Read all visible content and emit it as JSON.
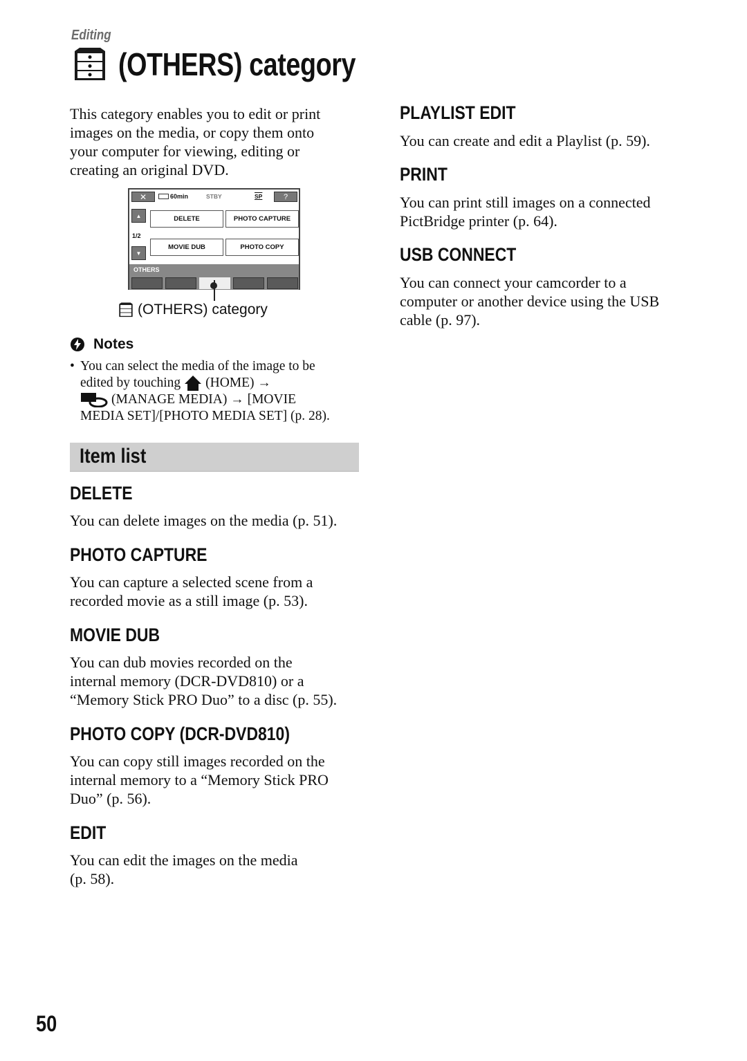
{
  "section_label": "Editing",
  "page_title": "(OTHERS) category",
  "intro": [
    "This category enables you to edit or print",
    "images on the media, or copy them onto",
    "your computer for viewing, editing or",
    "creating an original DVD."
  ],
  "screen": {
    "close_label": "✕",
    "battery": "60min",
    "status": "STBY",
    "quality": "SP",
    "help_label": "?",
    "page_indicator": "1/2",
    "buttons": [
      "DELETE",
      "PHOTO CAPTURE",
      "MOVIE DUB",
      "PHOTO COPY"
    ],
    "category_bar": "OTHERS",
    "caption": "(OTHERS) category"
  },
  "notes": {
    "heading": "Notes",
    "lines": [
      "You can select the media of the image to be",
      "edited by touching",
      "(HOME) →",
      "(MANAGE MEDIA) → [MOVIE",
      "MEDIA SET]/[PHOTO MEDIA SET] (p. 28)."
    ]
  },
  "item_list_heading": "Item list",
  "items_left": [
    {
      "title": "DELETE",
      "lines": [
        "You can delete images on the media (p. 51)."
      ]
    },
    {
      "title": "PHOTO CAPTURE",
      "lines": [
        "You can capture a selected scene from a",
        "recorded movie as a still image (p. 53)."
      ]
    },
    {
      "title": "MOVIE DUB",
      "lines": [
        "You can dub movies recorded on the",
        "internal memory (DCR-DVD810) or a",
        "“Memory Stick PRO Duo” to a disc (p. 55)."
      ]
    },
    {
      "title": "PHOTO COPY (DCR-DVD810)",
      "lines": [
        "You can copy still images recorded on the",
        "internal memory to a “Memory Stick PRO",
        "Duo” (p. 56)."
      ]
    },
    {
      "title": "EDIT",
      "lines": [
        "You can edit the images on the media",
        "(p. 58)."
      ]
    }
  ],
  "items_right": [
    {
      "title": "PLAYLIST EDIT",
      "lines": [
        "You can create and edit a Playlist (p. 59)."
      ]
    },
    {
      "title": "PRINT",
      "lines": [
        "You can print still images on a connected",
        "PictBridge printer (p. 64)."
      ]
    },
    {
      "title": "USB CONNECT",
      "lines": [
        "You can connect your camcorder to a",
        "computer or another device using the USB",
        "cable (p. 97)."
      ]
    }
  ],
  "page_number": "50"
}
